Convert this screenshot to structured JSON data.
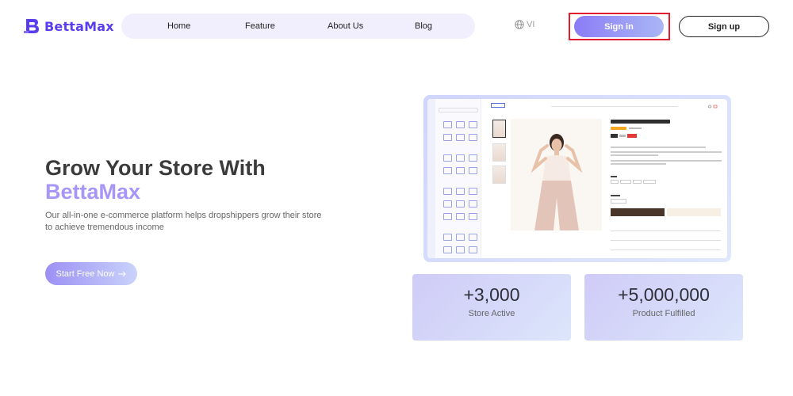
{
  "header": {
    "logo_text": "BettaMax",
    "nav": [
      "Home",
      "Feature",
      "About Us",
      "Blog"
    ],
    "language": "VI",
    "sign_in": "Sign in",
    "sign_up": "Sign up"
  },
  "hero": {
    "title": "Grow Your Store With",
    "brand": "BettaMax",
    "subtitle": "Our all-in-one e-commerce platform helps dropshippers grow their store to achieve tremendous income",
    "cta": "Start Free Now",
    "cta_icon": "arrow-right-icon"
  },
  "stats": [
    {
      "value": "+3,000",
      "label": "Store Active"
    },
    {
      "value": "+5,000,000",
      "label": "Product Fulfilled"
    }
  ],
  "colors": {
    "brand": "#5b3df0",
    "accent": "#a795f8",
    "highlight_border": "#e11d2e"
  }
}
